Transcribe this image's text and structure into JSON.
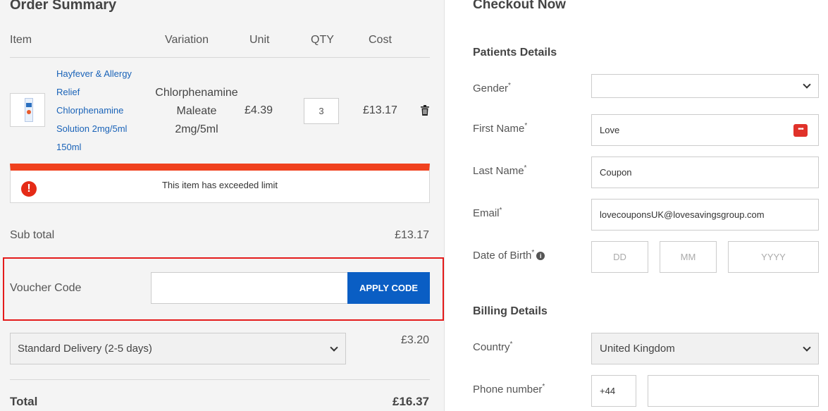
{
  "order": {
    "title": "Order Summary",
    "columns": {
      "item": "Item",
      "variation": "Variation",
      "unit": "Unit",
      "qty": "QTY",
      "cost": "Cost"
    },
    "item": {
      "name_lines": [
        "Hayfever & Allergy",
        "Relief",
        "Chlorphenamine",
        "Solution 2mg/5ml",
        "150ml"
      ],
      "variation_lines": [
        "Chlorphenamine",
        "Maleate",
        "2mg/5ml"
      ],
      "unit": "£4.39",
      "qty": "3",
      "cost": "£13.17",
      "delete_icon": "trash-icon"
    },
    "alert": {
      "icon": "exclamation-icon",
      "message": "This item has exceeded limit",
      "color": "#f0411e"
    },
    "subtotal": {
      "label": "Sub total",
      "value": "£13.17"
    },
    "voucher": {
      "label": "Voucher Code",
      "value": "",
      "button": "APPLY CODE",
      "highlight_color": "#e41b1b"
    },
    "delivery": {
      "selected": "Standard Delivery (2-5 days)",
      "price": "£3.20"
    },
    "total": {
      "label": "Total",
      "value": "£16.37"
    }
  },
  "checkout": {
    "title": "Checkout Now",
    "patients_heading": "Patients Details",
    "gender": {
      "label": "Gender",
      "value": ""
    },
    "first_name": {
      "label": "First Name",
      "value": "Love",
      "icon": "password-manager-icon"
    },
    "last_name": {
      "label": "Last Name",
      "value": "Coupon"
    },
    "email": {
      "label": "Email",
      "value": "lovecouponsUK@lovesavingsgroup.com"
    },
    "dob": {
      "label": "Date of Birth",
      "day_placeholder": "DD",
      "month_placeholder": "MM",
      "year_placeholder": "YYYY",
      "icon": "info-icon"
    },
    "billing_heading": "Billing Details",
    "country": {
      "label": "Country",
      "value": "United Kingdom"
    },
    "phone": {
      "label": "Phone number",
      "code": "+44",
      "value": ""
    },
    "required_mark": "*"
  },
  "colors": {
    "accent": "#0a5ec4",
    "link": "#1a63b8",
    "panel_bg": "#f4f4f4"
  }
}
